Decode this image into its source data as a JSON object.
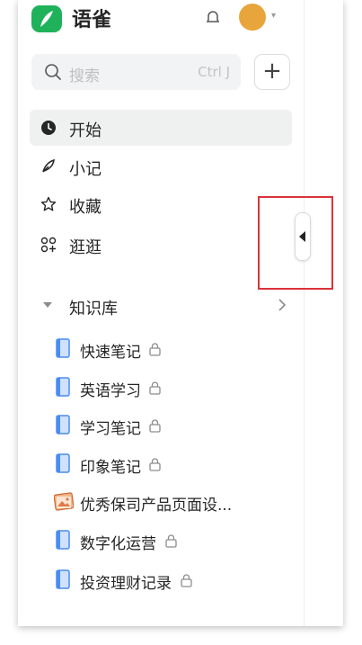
{
  "header": {
    "brand": "语雀"
  },
  "search": {
    "placeholder": "搜索",
    "shortcut": "Ctrl J"
  },
  "add_button": {
    "label": "+"
  },
  "nav": [
    {
      "label": "开始",
      "icon": "clock-icon",
      "active": true
    },
    {
      "label": "小记",
      "icon": "feather-icon"
    },
    {
      "label": "收藏",
      "icon": "star-icon"
    },
    {
      "label": "逛逛",
      "icon": "grid-icon"
    }
  ],
  "library": {
    "title": "知识库",
    "books": [
      {
        "name": "快速笔记",
        "locked": true,
        "icon": "book-icon"
      },
      {
        "name": "英语学习",
        "locked": true,
        "icon": "book-icon"
      },
      {
        "name": "学习笔记",
        "locked": true,
        "icon": "book-icon"
      },
      {
        "name": "印象笔记",
        "locked": true,
        "icon": "book-icon"
      },
      {
        "name": "优秀保司产品页面设...",
        "locked": false,
        "icon": "picture-book-icon"
      },
      {
        "name": "数字化运营",
        "locked": true,
        "icon": "book-icon"
      },
      {
        "name": "投资理财记录",
        "locked": true,
        "icon": "book-icon"
      }
    ]
  },
  "colors": {
    "brand_green": "#1fb25a",
    "book_blue": "#4a8cf0",
    "highlight_red": "#d9343a"
  }
}
